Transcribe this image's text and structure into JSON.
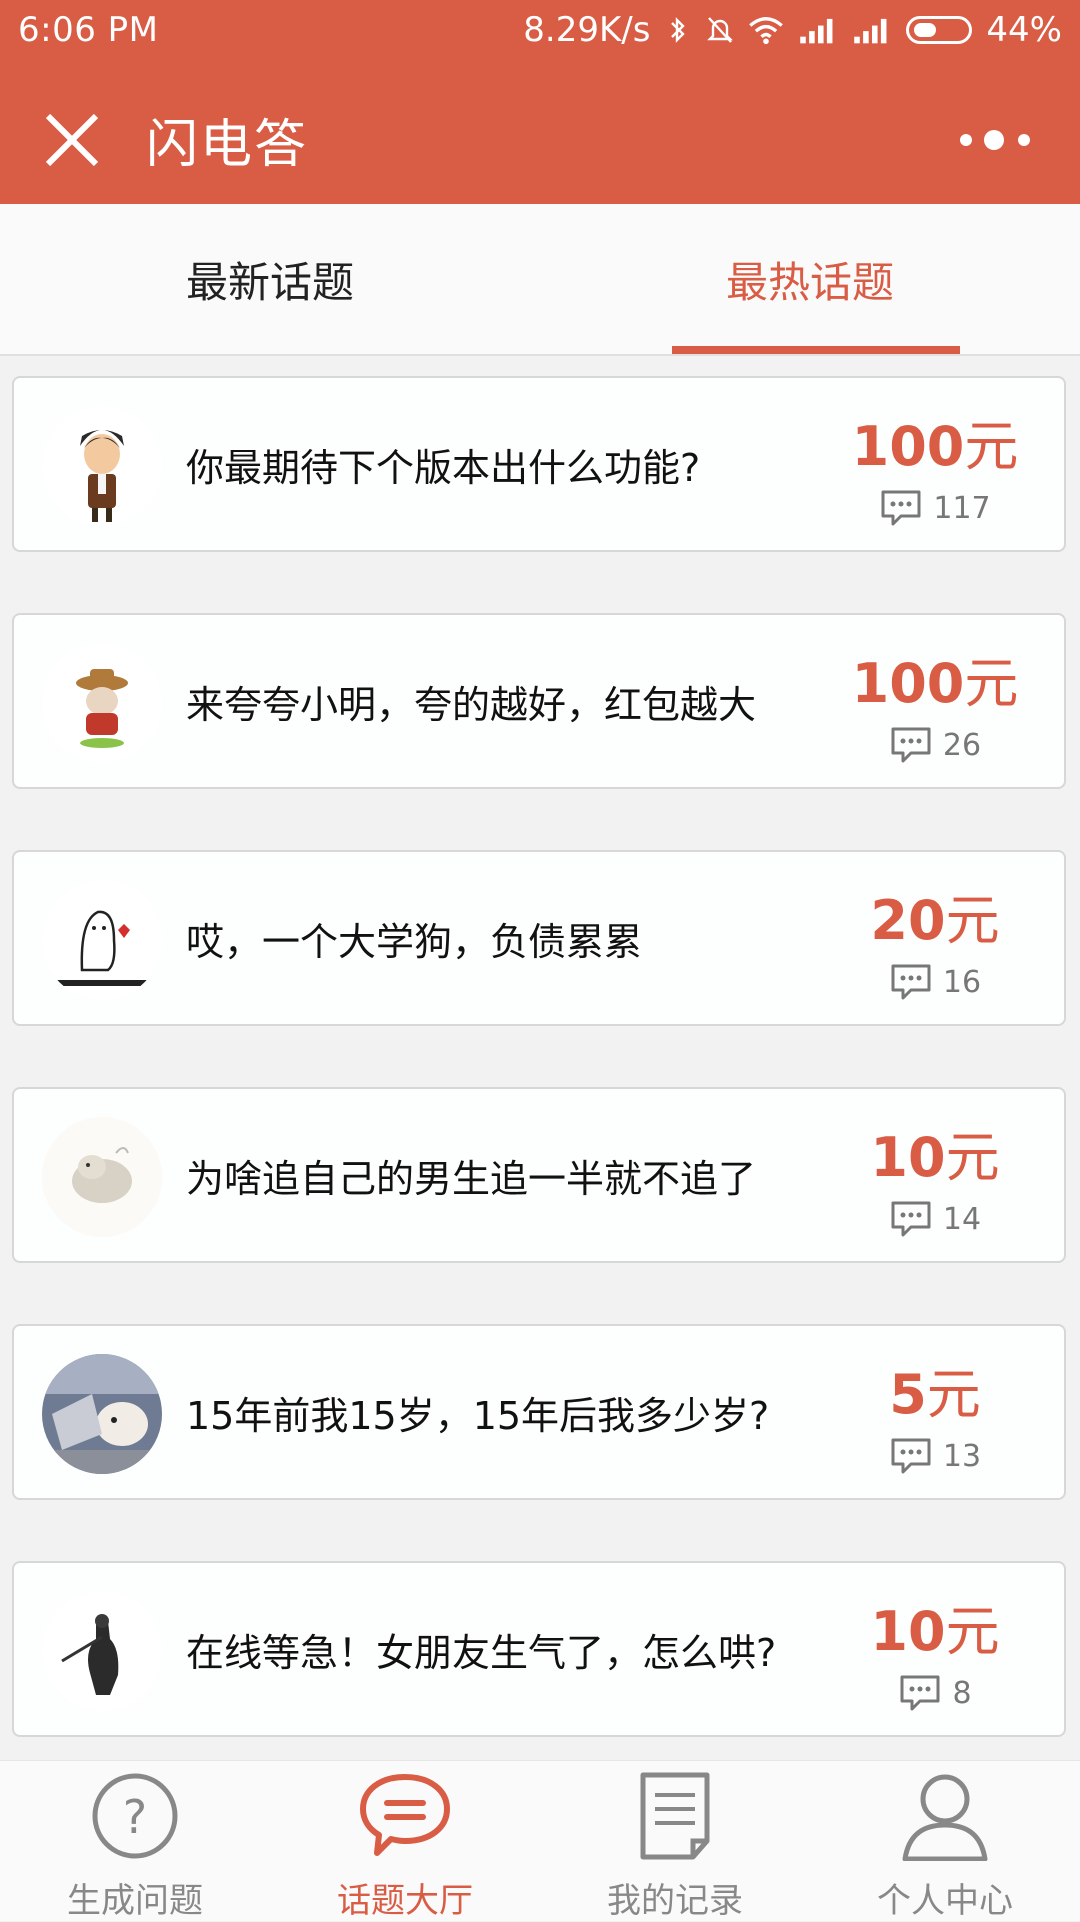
{
  "status_bar": {
    "time": "6:06 PM",
    "network_speed": "8.29K/s",
    "battery_percent": "44%",
    "icons": [
      "bluetooth-icon",
      "silent-bell-icon",
      "wifi-icon",
      "signal-icon",
      "signal-icon",
      "battery-icon"
    ]
  },
  "header": {
    "title": "闪电答",
    "close_icon": "close-icon",
    "more_icon": "more-dots-icon"
  },
  "tabs": [
    {
      "label": "最新话题",
      "active": false
    },
    {
      "label": "最热话题",
      "active": true
    }
  ],
  "topics": [
    {
      "title": "你最期待下个版本出什么功能?",
      "amount": "100",
      "unit": "元",
      "comments": "117"
    },
    {
      "title": "来夸夸小明，夸的越好，红包越大",
      "amount": "100",
      "unit": "元",
      "comments": "26"
    },
    {
      "title": "哎，一个大学狗，负债累累",
      "amount": "20",
      "unit": "元",
      "comments": "16"
    },
    {
      "title": "为啥追自己的男生追一半就不追了",
      "amount": "10",
      "unit": "元",
      "comments": "14"
    },
    {
      "title": "15年前我15岁，15年后我多少岁?",
      "amount": "5",
      "unit": "元",
      "comments": "13"
    },
    {
      "title": "在线等急！女朋友生气了，怎么哄?",
      "amount": "10",
      "unit": "元",
      "comments": "8"
    }
  ],
  "bottom_nav": [
    {
      "label": "生成问题",
      "icon": "question-circle-icon",
      "active": false
    },
    {
      "label": "话题大厅",
      "icon": "chat-bubble-icon",
      "active": true
    },
    {
      "label": "我的记录",
      "icon": "document-icon",
      "active": false
    },
    {
      "label": "个人中心",
      "icon": "person-icon",
      "active": false
    }
  ],
  "colors": {
    "accent": "#d95c45",
    "text": "#111111",
    "muted": "#888888"
  }
}
